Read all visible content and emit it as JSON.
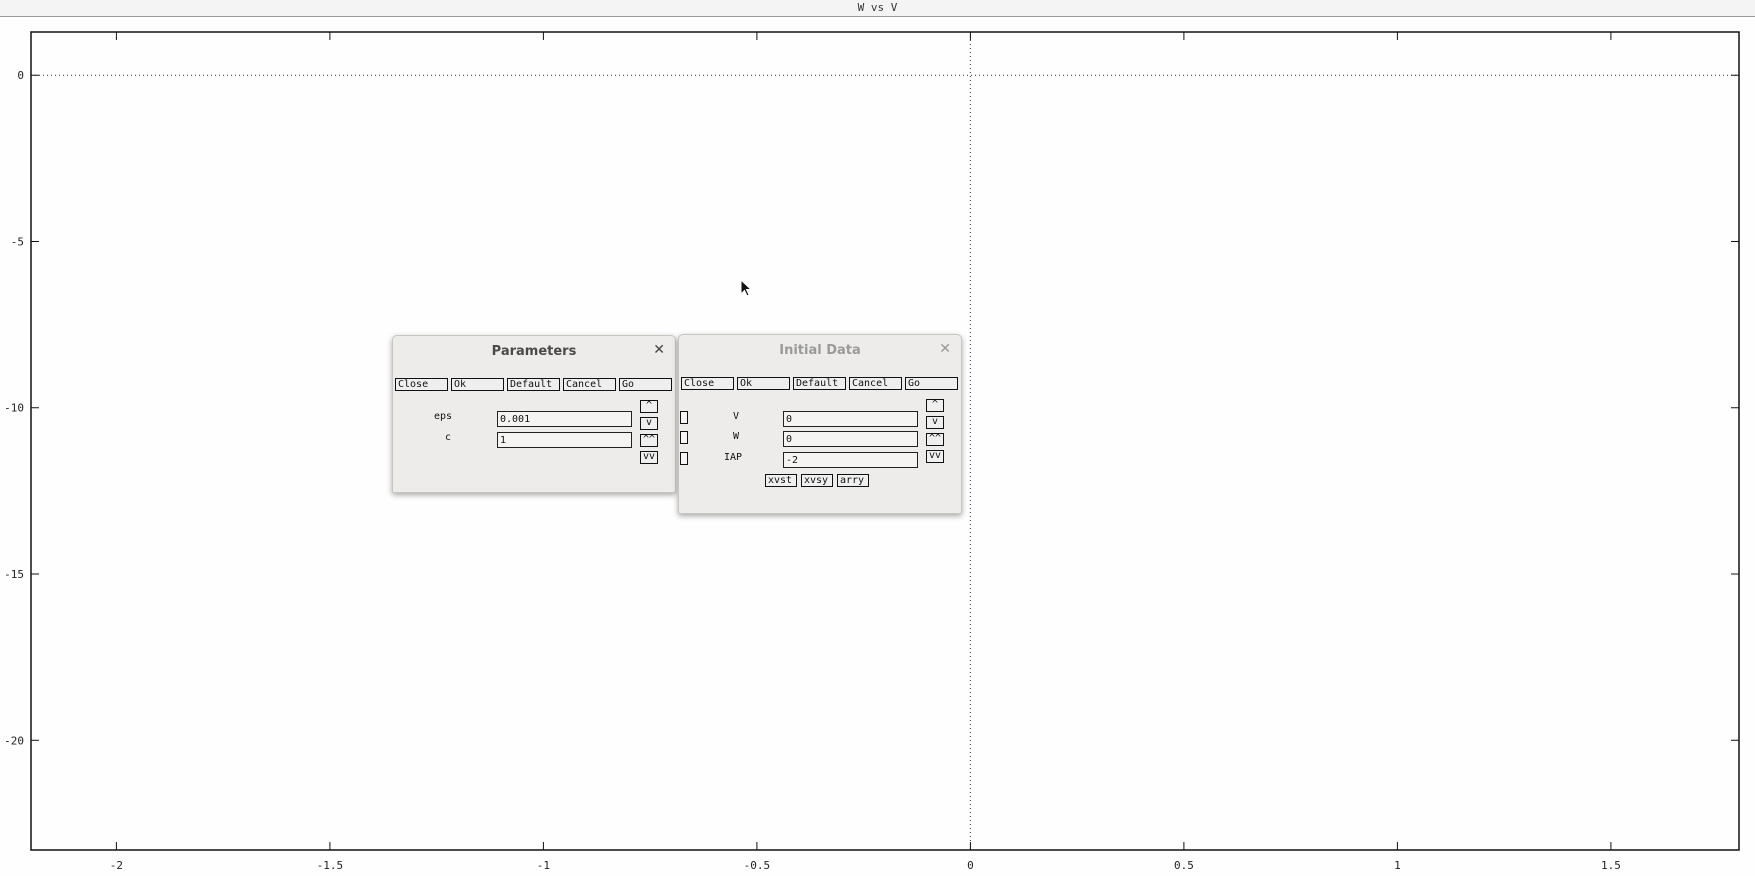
{
  "window": {
    "title": "W vs V"
  },
  "chart_data": {
    "type": "line",
    "title": "W vs V",
    "xlim": [
      -2.2,
      1.8
    ],
    "ylim": [
      -23.3,
      1.3
    ],
    "x_ticks": [
      -2,
      -1.5,
      -1,
      -0.5,
      0,
      0.5,
      1,
      1.5
    ],
    "y_ticks": [
      0,
      -5,
      -10,
      -15,
      -20
    ],
    "series": [],
    "grid": false,
    "zero_axes": "dotted"
  },
  "parameters": {
    "title": "Parameters",
    "buttons": [
      "Close",
      "Ok",
      "Default",
      "Cancel",
      "Go"
    ],
    "scroll": [
      "^",
      "v",
      "^^",
      "vv"
    ],
    "rows": [
      {
        "name": "eps",
        "value": "0.001"
      },
      {
        "name": "c",
        "value": "1"
      }
    ]
  },
  "initial_data": {
    "title": "Initial Data",
    "buttons": [
      "Close",
      "Ok",
      "Default",
      "Cancel",
      "Go"
    ],
    "scroll": [
      "^",
      "v",
      "^^",
      "vv"
    ],
    "rows": [
      {
        "name": "V",
        "value": "0"
      },
      {
        "name": "W",
        "value": "0"
      },
      {
        "name": "IAP",
        "value": "-2"
      }
    ],
    "plot_buttons": [
      "xvst",
      "xvsy",
      "arry"
    ]
  },
  "icons": {
    "close": "close-icon",
    "cursor": "mouse-pointer-icon"
  }
}
